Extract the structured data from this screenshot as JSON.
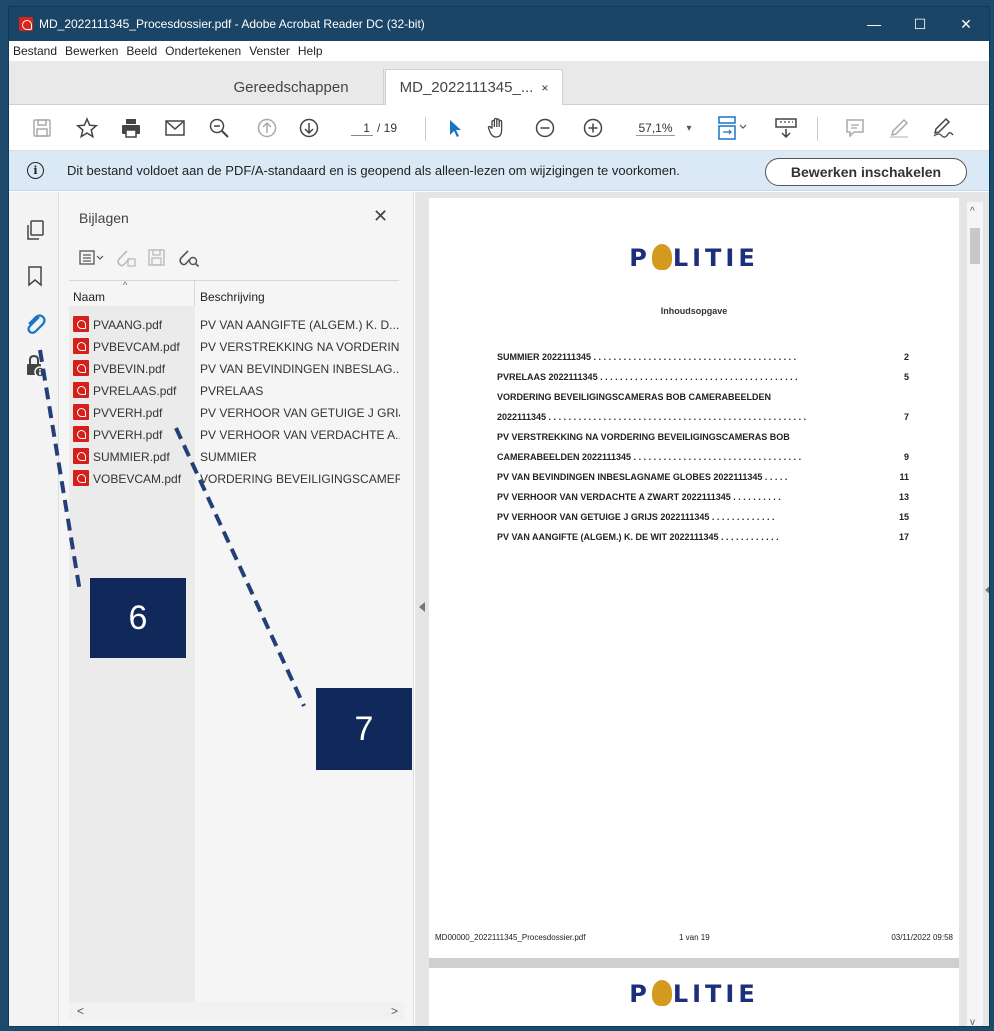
{
  "window": {
    "title": "MD_2022111345_Procesdossier.pdf - Adobe Acrobat Reader DC (32-bit)",
    "minimize": "—",
    "maximize": "☐",
    "close": "✕"
  },
  "menu": [
    "Bestand",
    "Bewerken",
    "Beeld",
    "Ondertekenen",
    "Venster",
    "Help"
  ],
  "tabs": {
    "tools": "Gereedschappen",
    "document": "MD_2022111345_...",
    "close": "×"
  },
  "toolbar": {
    "page_current": "1",
    "page_total": "/ 19",
    "zoom": "57,1%",
    "zoom_caret": "▾"
  },
  "infobar": {
    "icon": "i",
    "message": "Dit bestand voldoet aan de PDF/A-standaard en is geopend als alleen-lezen om wijzigingen te voorkomen.",
    "enable_button": "Bewerken inschakelen"
  },
  "attachments_panel": {
    "title": "Bijlagen",
    "close": "✕",
    "col_name": "Naam",
    "col_desc": "Beschrijving",
    "sort_caret": "^",
    "items": [
      {
        "name": "PVAANG.pdf",
        "desc": "PV VAN AANGIFTE (ALGEM.) K. D..."
      },
      {
        "name": "PVBEVCAM.pdf",
        "desc": "PV VERSTREKKING NA VORDERIN..."
      },
      {
        "name": "PVBEVIN.pdf",
        "desc": "PV VAN BEVINDINGEN INBESLAG..."
      },
      {
        "name": "PVRELAAS.pdf",
        "desc": "PVRELAAS"
      },
      {
        "name": "PVVERH.pdf",
        "desc": "PV VERHOOR VAN GETUIGE J GRIJS"
      },
      {
        "name": "PVVERH.pdf",
        "desc": "PV VERHOOR VAN VERDACHTE A..."
      },
      {
        "name": "SUMMIER.pdf",
        "desc": "SUMMIER"
      },
      {
        "name": "VOBEVCAM.pdf",
        "desc": "VORDERING BEVEILIGINGSCAMER..."
      }
    ],
    "scroll_left": "<",
    "scroll_right": ">"
  },
  "document": {
    "logo_left": "P",
    "logo_right": "LITIE",
    "heading": "Inhoudsopgave",
    "toc": [
      {
        "title": "SUMMIER 2022111345 . . . . . . . . . . . . . . . . . . . . . . . . . . . . . . . . . . . . . . . . .",
        "page": "2"
      },
      {
        "title": "PVRELAAS 2022111345 . . . . . . . . . . . . . . . . . . . . . . . . . . . . . . . . . . . . . . . .",
        "page": "5"
      },
      {
        "title": "VORDERING BEVEILIGINGSCAMERAS BOB CAMERABEELDEN",
        "page": ""
      },
      {
        "title": "2022111345 . . . . . . . . . . . . . . . . . . . . . . . . . . . . . . . . . . . . . . . . . . . . . . . . . . . .",
        "page": "7"
      },
      {
        "title": "PV VERSTREKKING NA VORDERING BEVEILIGINGSCAMERAS BOB",
        "page": ""
      },
      {
        "title": "CAMERABEELDEN 2022111345 . . . . . . . . . . . . . . . . . . . . . . . . . . . . . . . . . .",
        "page": "9"
      },
      {
        "title": "PV VAN BEVINDINGEN INBESLAGNAME GLOBES 2022111345  . . . . .",
        "page": "11"
      },
      {
        "title": "PV VERHOOR VAN VERDACHTE A ZWART 2022111345  . . . . . . . . . .",
        "page": "13"
      },
      {
        "title": "PV VERHOOR VAN GETUIGE J GRIJS 2022111345  . . . . . . . . . . . . .",
        "page": "15"
      },
      {
        "title": "PV VAN AANGIFTE (ALGEM.) K. DE WIT 2022111345  . . . . . . . . . . . .",
        "page": "17"
      }
    ],
    "footer_file": "MD00000_2022111345_Procesdossier.pdf",
    "footer_page": "1 van 19",
    "footer_date": "03/11/2022 09:58"
  },
  "callouts": {
    "six": "6",
    "seven": "7"
  },
  "scroll": {
    "up": "^",
    "down": "v"
  }
}
